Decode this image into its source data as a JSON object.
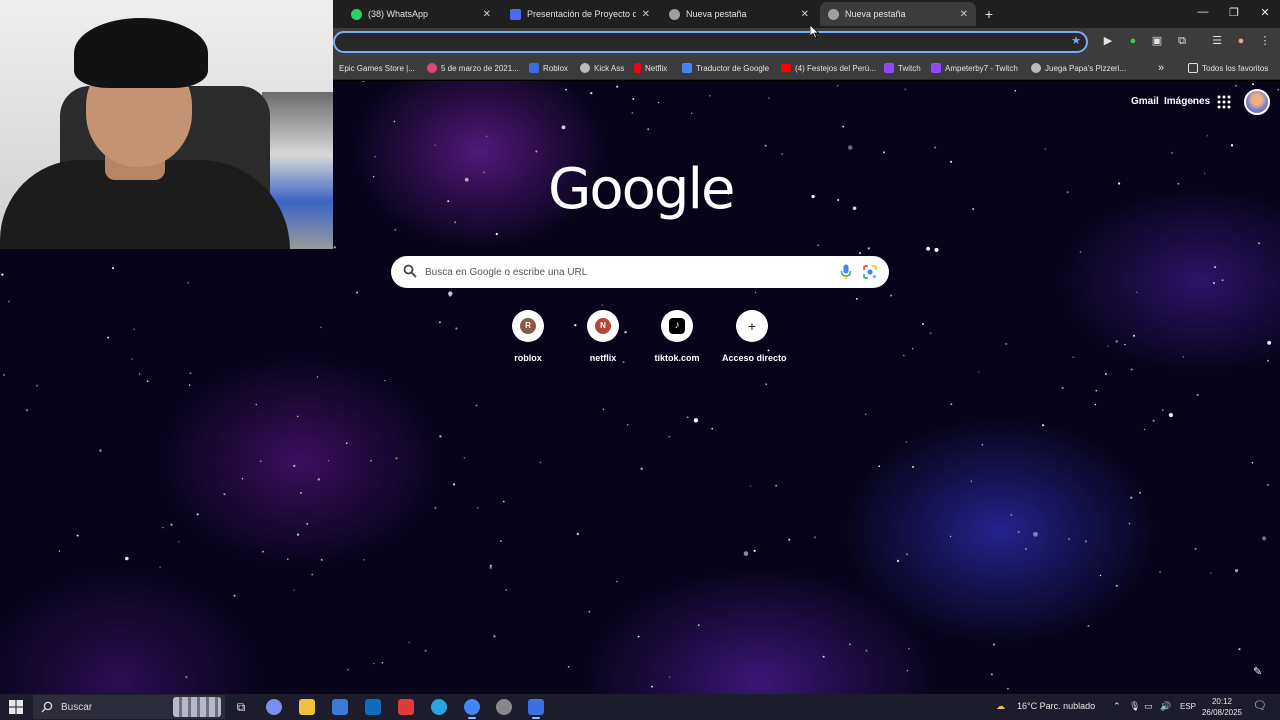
{
  "tabs": [
    {
      "label": "(38) WhatsApp",
      "favicon_color": "#25d366",
      "active": false
    },
    {
      "label": "Presentación de Proyecto de E",
      "favicon_color": "#4f6bed",
      "active": false
    },
    {
      "label": "Nueva pestaña",
      "favicon_color": "#9aa0a6",
      "active": false
    },
    {
      "label": "Nueva pestaña",
      "favicon_color": "#9aa0a6",
      "active": true
    }
  ],
  "close_glyph": "✕",
  "new_tab_glyph": "+",
  "window_controls": {
    "minimize": "—",
    "maximize": "❐",
    "close": "✕"
  },
  "bookmarks": [
    {
      "label": "Epic Games Store |...",
      "color": "#222222"
    },
    {
      "label": "5 de marzo de 2021...",
      "color": "#e0457b"
    },
    {
      "label": "Roblox",
      "color": "#3b6de0"
    },
    {
      "label": "Kick Ass",
      "color": "#bbbbbb"
    },
    {
      "label": "Netflix",
      "color": "#e50914"
    },
    {
      "label": "Traductor de Google",
      "color": "#4285f4"
    },
    {
      "label": "(4) Festejos del Perú...",
      "color": "#ff0000"
    },
    {
      "label": "Twitch",
      "color": "#9146ff"
    },
    {
      "label": "Ampeterby7 - Twitch",
      "color": "#9146ff"
    },
    {
      "label": "Juega Papa's Pizzeri...",
      "color": "#bbbbbb"
    }
  ],
  "bookmarks_more": "»",
  "all_bookmarks": "Todos los favoritos",
  "header_links": {
    "gmail": "Gmail",
    "images": "Imágenes"
  },
  "logo_text": "Google",
  "search": {
    "placeholder": "Busca en Google o escribe una URL"
  },
  "shortcuts": [
    {
      "label": "roblox",
      "letter": "R",
      "color": "#8d5a45"
    },
    {
      "label": "netflix",
      "letter": "N",
      "color": "#b2473a"
    },
    {
      "label": "tiktok.com",
      "letter": "♪",
      "color": "#000000"
    },
    {
      "label": "Acceso directo",
      "letter": "+",
      "color": "#ffffff"
    }
  ],
  "taskbar": {
    "search_label": "Buscar",
    "apps": [
      "#7c8cf0",
      "#f0c040",
      "#3a7bd5",
      "#0f6cbd",
      "#e03a3a",
      "#2aa4e0",
      "#4285f4",
      "#888888",
      "#3a70e0"
    ],
    "weather": "16°C  Parc. nublado",
    "language": "ESP",
    "time": "20:12",
    "date": "26/08/2025"
  }
}
